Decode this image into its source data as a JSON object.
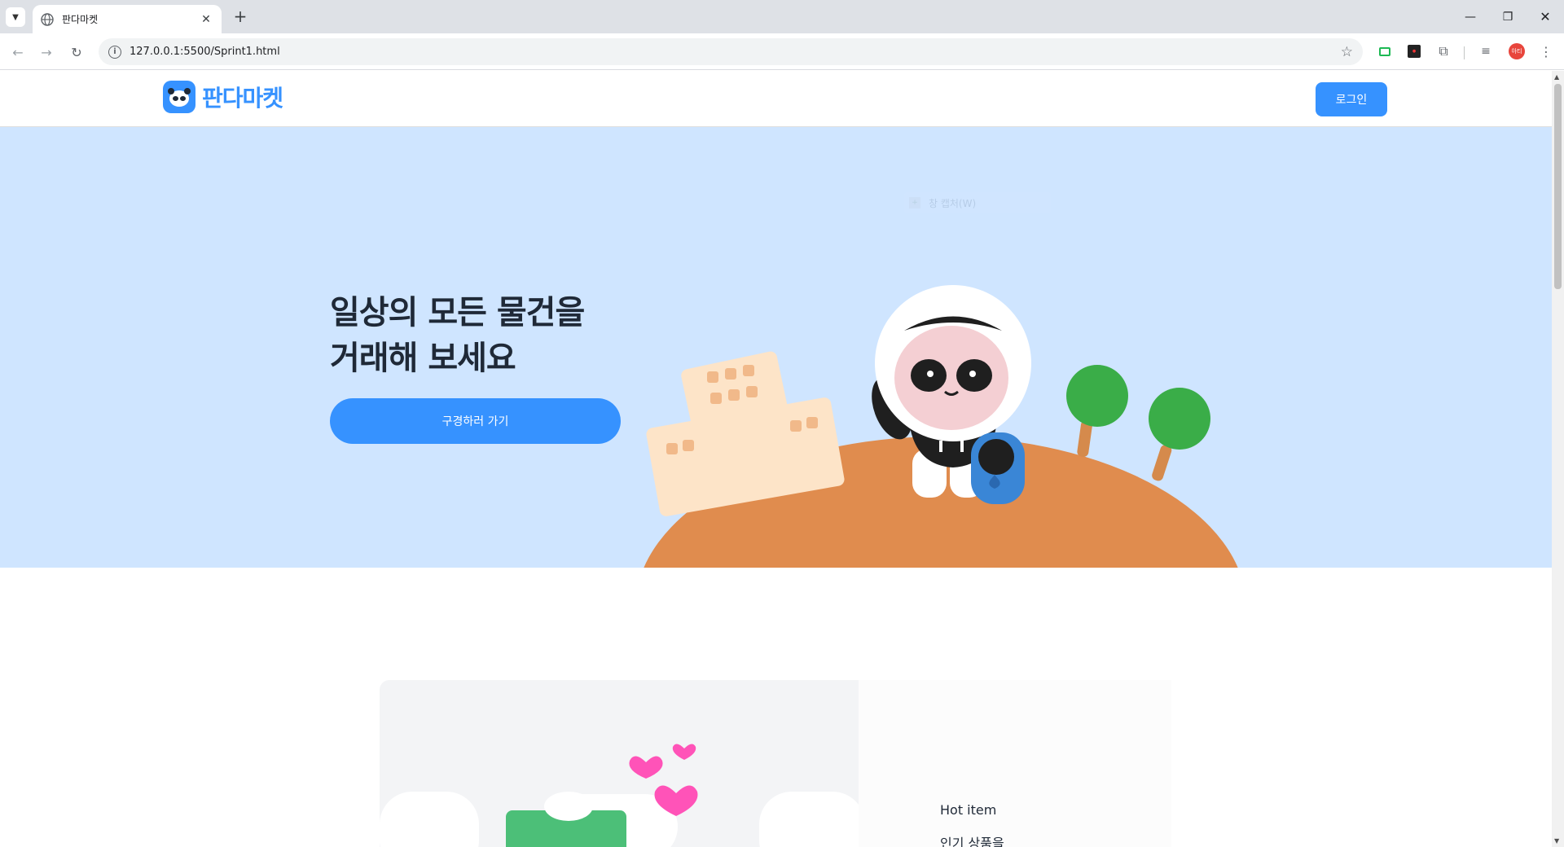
{
  "browser": {
    "tab_title": "판다마켓",
    "url": "127.0.0.1:5500/Sprint1.html",
    "tab_close": "✕",
    "new_tab": "+",
    "window_controls": {
      "minimize": "—",
      "maximize": "❐",
      "close": "✕"
    },
    "extension_avatar": "아티"
  },
  "header": {
    "logo_text": "판다마켓",
    "login_label": "로그인"
  },
  "hero": {
    "title_line1": "일상의 모든 물건을",
    "title_line2": "거래해 보세요",
    "cta_label": "구경하러 가기",
    "ghost_text": "창 캡처(W)"
  },
  "feature": {
    "label": "Hot item",
    "heading": "인기 상품을"
  },
  "colors": {
    "brand": "#3692ff",
    "hero_bg": "#cfe5ff",
    "hill": "#e08c4e",
    "tree": "#3aad48"
  }
}
